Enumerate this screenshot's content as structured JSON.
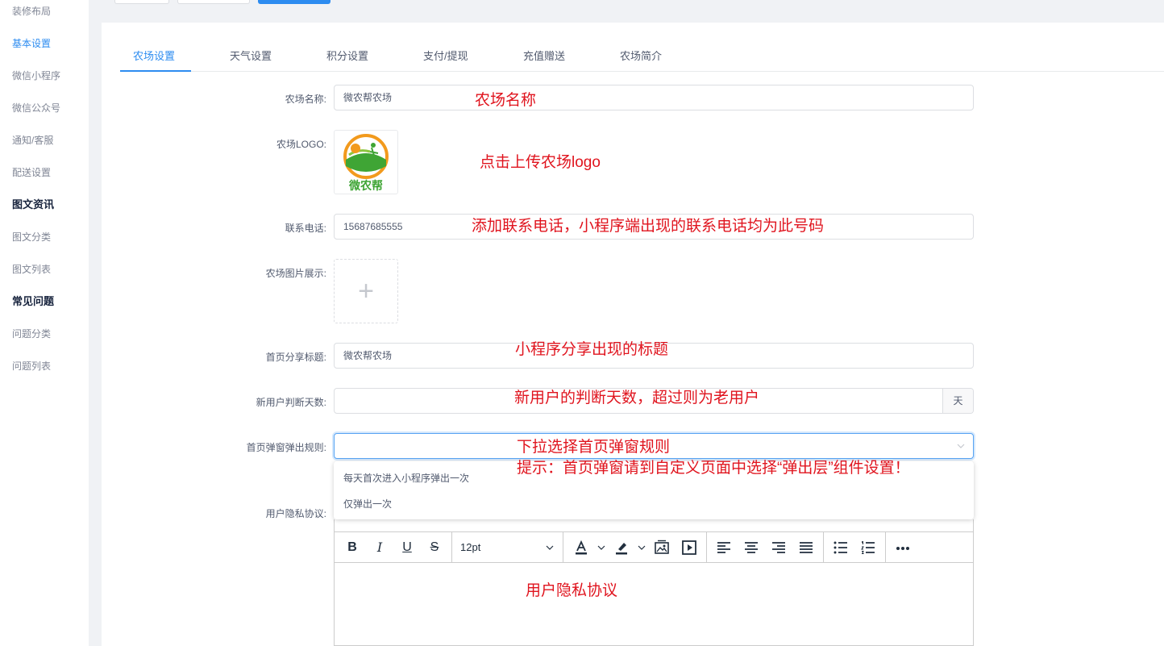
{
  "sidebar": {
    "items": [
      {
        "label": "装修布局"
      },
      {
        "label": "基本设置"
      },
      {
        "label": "微信小程序"
      },
      {
        "label": "微信公众号"
      },
      {
        "label": "通知/客服"
      },
      {
        "label": "配送设置"
      },
      {
        "label": "图文资讯"
      },
      {
        "label": "图文分类"
      },
      {
        "label": "图文列表"
      },
      {
        "label": "常见问题"
      },
      {
        "label": "问题分类"
      },
      {
        "label": "问题列表"
      }
    ]
  },
  "tabs": [
    {
      "label": "农场设置"
    },
    {
      "label": "天气设置"
    },
    {
      "label": "积分设置"
    },
    {
      "label": "支付/提现"
    },
    {
      "label": "充值赠送"
    },
    {
      "label": "农场简介"
    }
  ],
  "form": {
    "farm_name": {
      "label": "农场名称:",
      "value": "微农帮农场"
    },
    "farm_logo": {
      "label": "农场LOGO:",
      "logo_text": "微农帮"
    },
    "phone": {
      "label": "联系电话:",
      "value": "15687685555"
    },
    "farm_images": {
      "label": "农场图片展示:",
      "plus": "+"
    },
    "share_title": {
      "label": "首页分享标题:",
      "value": "微农帮农场"
    },
    "new_user_days": {
      "label": "新用户判断天数:",
      "value": "",
      "suffix": "天"
    },
    "popup_rule": {
      "label": "首页弹窗弹出规则:",
      "value": "",
      "options": [
        "每天首次进入小程序弹出一次",
        "仅弹出一次"
      ]
    },
    "privacy": {
      "label": "用户隐私协议:"
    }
  },
  "editor": {
    "font_size": "12pt"
  },
  "annotations": {
    "farm_name": "农场名称",
    "logo": "点击上传农场logo",
    "phone": "添加联系电话，小程序端出现的联系电话均为此号码",
    "share_title": "小程序分享出现的标题",
    "new_user": "新用户的判断天数，超过则为老用户",
    "popup": "下拉选择首页弹窗规则",
    "popup_tip": "提示：首页弹窗请到自定义页面中选择“弹出层”组件设置！",
    "privacy": "用户隐私协议"
  },
  "colors": {
    "accent": "#2d8cf0",
    "annotation": "#e0141e"
  }
}
